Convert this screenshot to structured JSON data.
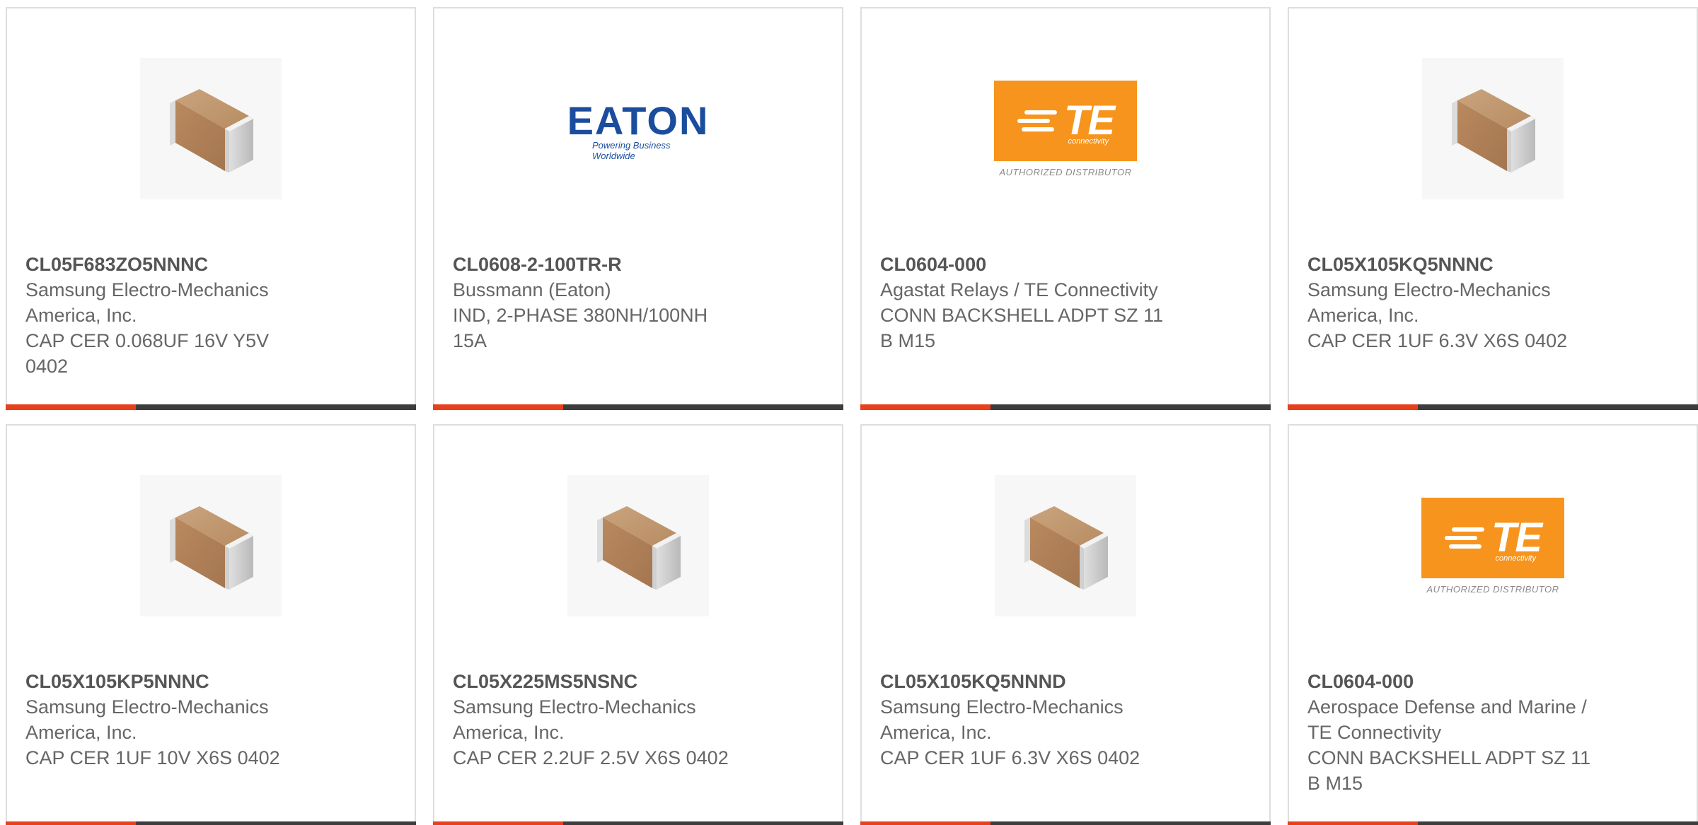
{
  "colors": {
    "accent": "#e8401c",
    "bar": "#3d3d3d",
    "te_orange": "#f7941d",
    "eaton_blue": "#1b4d9e"
  },
  "products": [
    {
      "part_number": "CL05F683ZO5NNNC",
      "manufacturer": "Samsung Electro-Mechanics America, Inc.",
      "description": "CAP CER 0.068UF 16V Y5V 0402",
      "image": "capacitor-chip"
    },
    {
      "part_number": "CL0608-2-100TR-R",
      "manufacturer": "Bussmann (Eaton)",
      "description": "IND, 2-PHASE 380NH/100NH 15A",
      "image": "eaton-logo",
      "logo_word": "EATON",
      "logo_tagline": "Powering Business Worldwide"
    },
    {
      "part_number": "CL0604-000",
      "manufacturer": "Agastat Relays / TE Connectivity",
      "description": "CONN BACKSHELL ADPT SZ 11 B M15",
      "image": "te-logo",
      "logo_mark": "TE",
      "logo_sub": "connectivity",
      "logo_caption": "AUTHORIZED DISTRIBUTOR"
    },
    {
      "part_number": "CL05X105KQ5NNNC",
      "manufacturer": "Samsung Electro-Mechanics America, Inc.",
      "description": "CAP CER 1UF 6.3V X6S 0402",
      "image": "capacitor-chip"
    },
    {
      "part_number": "CL05X105KP5NNNC",
      "manufacturer": "Samsung Electro-Mechanics America, Inc.",
      "description": "CAP CER 1UF 10V X6S 0402",
      "image": "capacitor-chip"
    },
    {
      "part_number": "CL05X225MS5NSNC",
      "manufacturer": "Samsung Electro-Mechanics America, Inc.",
      "description": "CAP CER 2.2UF 2.5V X6S 0402",
      "image": "capacitor-chip"
    },
    {
      "part_number": "CL05X105KQ5NNND",
      "manufacturer": "Samsung Electro-Mechanics America, Inc.",
      "description": "CAP CER 1UF 6.3V X6S 0402",
      "image": "capacitor-chip"
    },
    {
      "part_number": "CL0604-000",
      "manufacturer": "Aerospace Defense and Marine / TE Connectivity",
      "description": "CONN BACKSHELL ADPT SZ 11 B M15",
      "image": "te-logo",
      "logo_mark": "TE",
      "logo_sub": "connectivity",
      "logo_caption": "AUTHORIZED DISTRIBUTOR"
    }
  ]
}
